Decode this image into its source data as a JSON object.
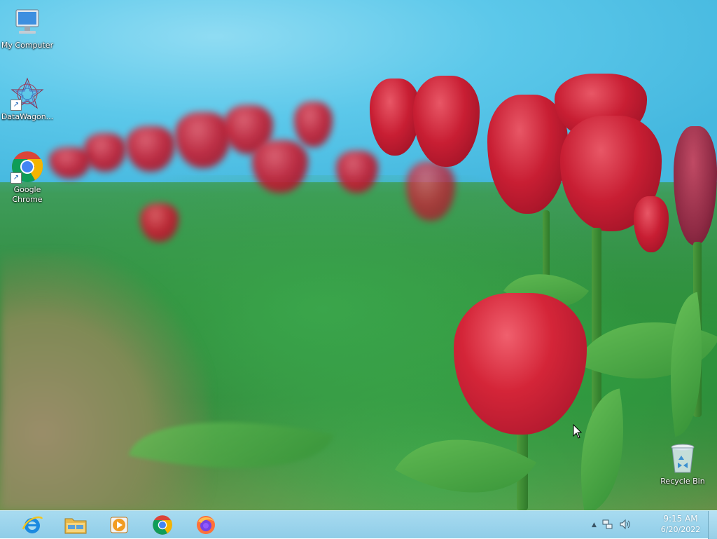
{
  "desktop": {
    "icons": [
      {
        "label": "My Computer",
        "icon": "computer-icon"
      },
      {
        "label": "DataWagon...",
        "icon": "datawagon-icon"
      },
      {
        "label": "Google Chrome",
        "icon": "chrome-icon"
      },
      {
        "label": "Recycle Bin",
        "icon": "recycle-bin-icon"
      }
    ]
  },
  "taskbar": {
    "pinned": [
      {
        "name": "Internet Explorer",
        "icon": "internet-explorer-icon"
      },
      {
        "name": "File Explorer",
        "icon": "folder-icon"
      },
      {
        "name": "Windows Media Player",
        "icon": "media-player-icon"
      },
      {
        "name": "Google Chrome",
        "icon": "chrome-icon"
      },
      {
        "name": "Firefox",
        "icon": "firefox-icon"
      }
    ],
    "tray": {
      "show_hidden": "▲",
      "network_icon": "network-icon",
      "volume_icon": "volume-icon"
    },
    "clock": {
      "time": "9:15 AM",
      "date": "6/20/2022"
    }
  },
  "colors": {
    "taskbar": "#9fd6ee",
    "tulip_red": "#c81e33",
    "sky": "#52c2e6"
  }
}
